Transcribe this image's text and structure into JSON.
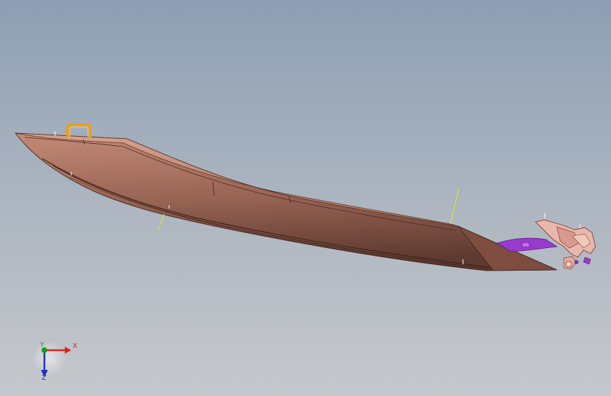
{
  "viewport": {
    "background_top": "#8e9fb3",
    "background_bottom": "#c6c8cc"
  },
  "model": {
    "body_color": "#a56e5e",
    "handle_color": "#e8a020",
    "bracket_color": "#9a3acc",
    "marker_color": "#e8e820"
  },
  "triad": {
    "x_label": "X",
    "y_label": "Y",
    "z_label": "Z",
    "x_color": "#e02020",
    "y_color": "#1a9a1a",
    "z_color": "#2030c0"
  }
}
